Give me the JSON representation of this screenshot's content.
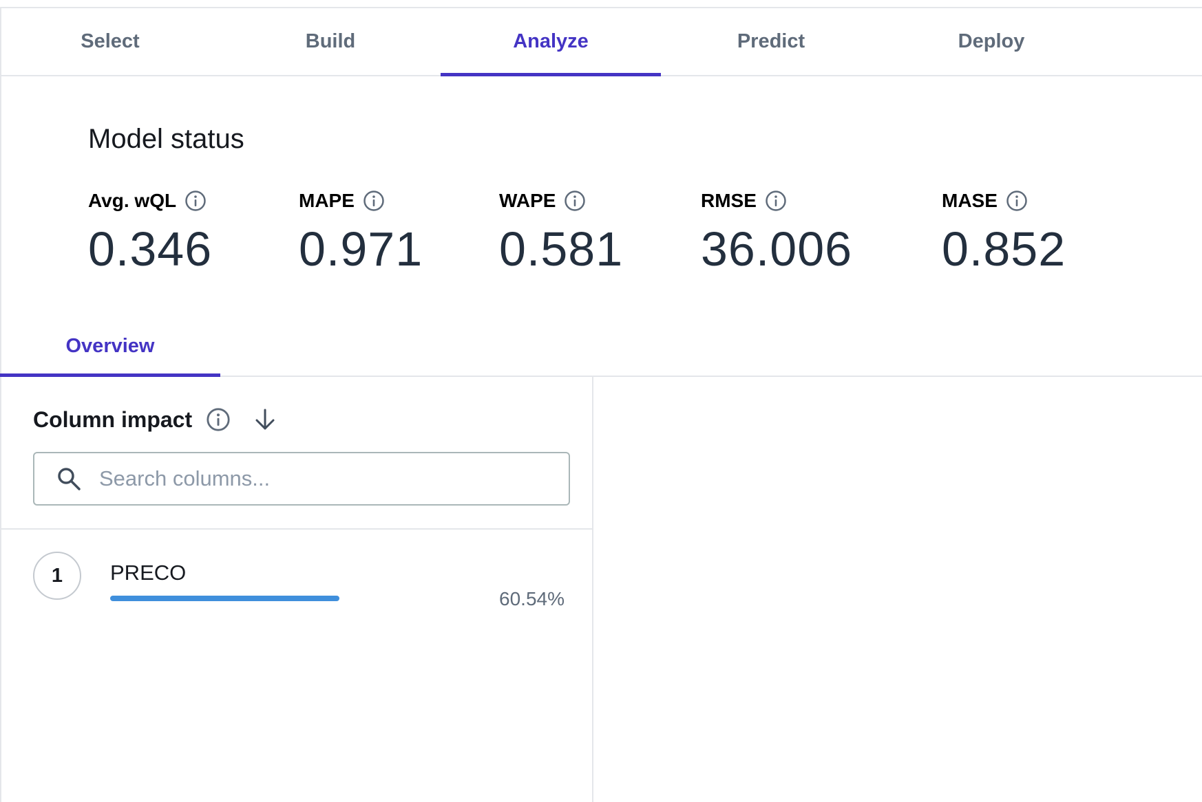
{
  "tabs": [
    {
      "label": "Select",
      "active": false
    },
    {
      "label": "Build",
      "active": false
    },
    {
      "label": "Analyze",
      "active": true
    },
    {
      "label": "Predict",
      "active": false
    },
    {
      "label": "Deploy",
      "active": false
    }
  ],
  "model_status": {
    "title": "Model status",
    "metrics": [
      {
        "label": "Avg. wQL",
        "value": "0.346"
      },
      {
        "label": "MAPE",
        "value": "0.971"
      },
      {
        "label": "WAPE",
        "value": "0.581"
      },
      {
        "label": "RMSE",
        "value": "36.006"
      },
      {
        "label": "MASE",
        "value": "0.852"
      }
    ]
  },
  "subtabs": [
    {
      "label": "Overview",
      "active": true
    }
  ],
  "column_impact": {
    "title": "Column impact",
    "search_placeholder": "Search columns...",
    "rows": [
      {
        "rank": "1",
        "name": "PRECO",
        "percent_label": "60.54%",
        "impact_fraction": 0.6054
      }
    ]
  },
  "colors": {
    "accent": "#4434c4",
    "bar": "#3f8fdc",
    "tab_inactive": "#5f6b7a"
  },
  "icons": [
    "info-icon",
    "arrow-down-icon",
    "search-icon"
  ]
}
